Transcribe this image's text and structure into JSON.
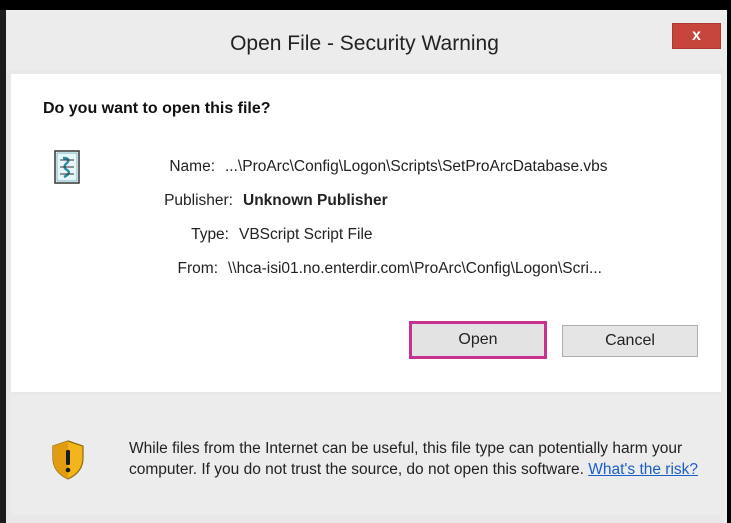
{
  "dialog": {
    "title": "Open File - Security Warning",
    "close_label": "x",
    "question": "Do you want to open this file?",
    "fields": {
      "name_label": "Name:",
      "name_value": "...\\ProArc\\Config\\Logon\\Scripts\\SetProArcDatabase.vbs",
      "publisher_label": "Publisher:",
      "publisher_value": "Unknown Publisher",
      "type_label": "Type:",
      "type_value": "VBScript Script File",
      "from_label": "From:",
      "from_value": "\\\\hca-isi01.no.enterdir.com\\ProArc\\Config\\Logon\\Scri..."
    },
    "buttons": {
      "open_label": "Open",
      "cancel_label": "Cancel"
    },
    "footer": {
      "warning_text": "While files from the Internet can be useful, this file type can potentially harm your computer. If you do not trust the source, do not open this software.",
      "risk_link": "What's the risk?"
    }
  },
  "colors": {
    "close_button": "#c7463b",
    "open_highlight": "#c3338f",
    "link": "#1a5fc8"
  },
  "icons": [
    "script-file-icon",
    "shield-warning-icon"
  ]
}
